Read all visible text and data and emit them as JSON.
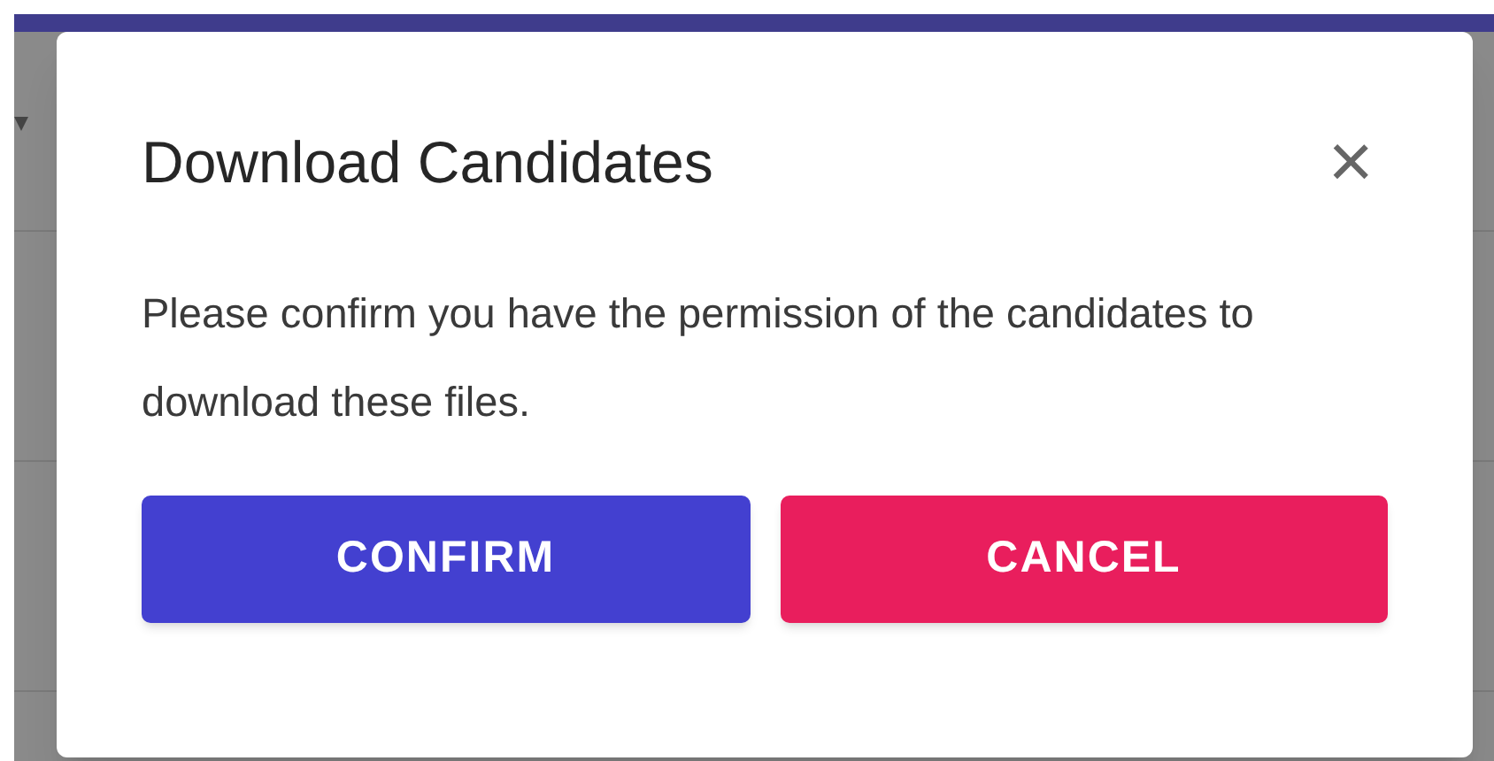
{
  "dialog": {
    "title": "Download Candidates",
    "close_label": "×",
    "message": "Please confirm you have the permission of the candidates to download these files."
  },
  "buttons": [
    {
      "label": "CONFIRM",
      "kind": "primary"
    },
    {
      "label": "CANCEL",
      "kind": "danger"
    }
  ]
}
